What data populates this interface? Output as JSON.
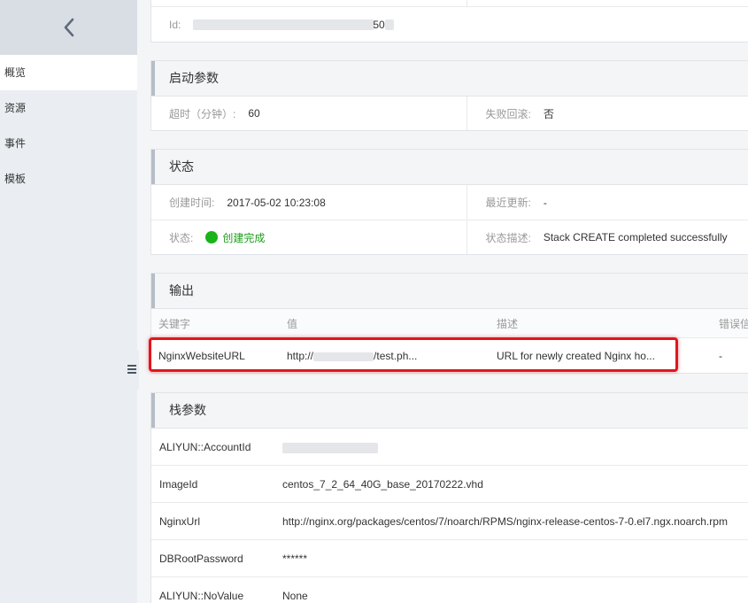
{
  "sidebar": {
    "items": [
      {
        "label": "概览",
        "active": true
      },
      {
        "label": "资源",
        "active": false
      },
      {
        "label": "事件",
        "active": false
      },
      {
        "label": "模板",
        "active": false
      }
    ]
  },
  "top_info": {
    "id_label": "Id:",
    "id_value": "50"
  },
  "startup_params": {
    "title": "启动参数",
    "timeout_label": "超时（分钟）:",
    "timeout_value": "60",
    "rollback_label": "失败回滚:",
    "rollback_value": "否"
  },
  "status": {
    "title": "状态",
    "created_label": "创建时间:",
    "created_value": "2017-05-02 10:23:08",
    "updated_label": "最近更新:",
    "updated_value": "-",
    "state_label": "状态:",
    "state_value": "创建完成",
    "state_color": "#1ab31a",
    "desc_label": "状态描述:",
    "desc_value": "Stack CREATE completed successfully"
  },
  "outputs": {
    "title": "输出",
    "columns": [
      "关键字",
      "值",
      "描述",
      "错误信"
    ],
    "rows": [
      {
        "key": "NginxWebsiteURL",
        "value": "http://",
        "value_tail": "/test.ph...",
        "description": "URL for newly created Nginx ho...",
        "error": "-"
      }
    ]
  },
  "stack_params": {
    "title": "栈参数",
    "rows": [
      {
        "key": "ALIYUN::AccountId",
        "value": ""
      },
      {
        "key": "ImageId",
        "value": "centos_7_2_64_40G_base_20170222.vhd"
      },
      {
        "key": "NginxUrl",
        "value": "http://nginx.org/packages/centos/7/noarch/RPMS/nginx-release-centos-7-0.el7.ngx.noarch.rpm"
      },
      {
        "key": "DBRootPassword",
        "value": "******"
      },
      {
        "key": "ALIYUN::NoValue",
        "value": "None"
      }
    ]
  },
  "colors": {
    "highlight": "#e0161d",
    "sidebar_bg": "#eaedf1"
  }
}
